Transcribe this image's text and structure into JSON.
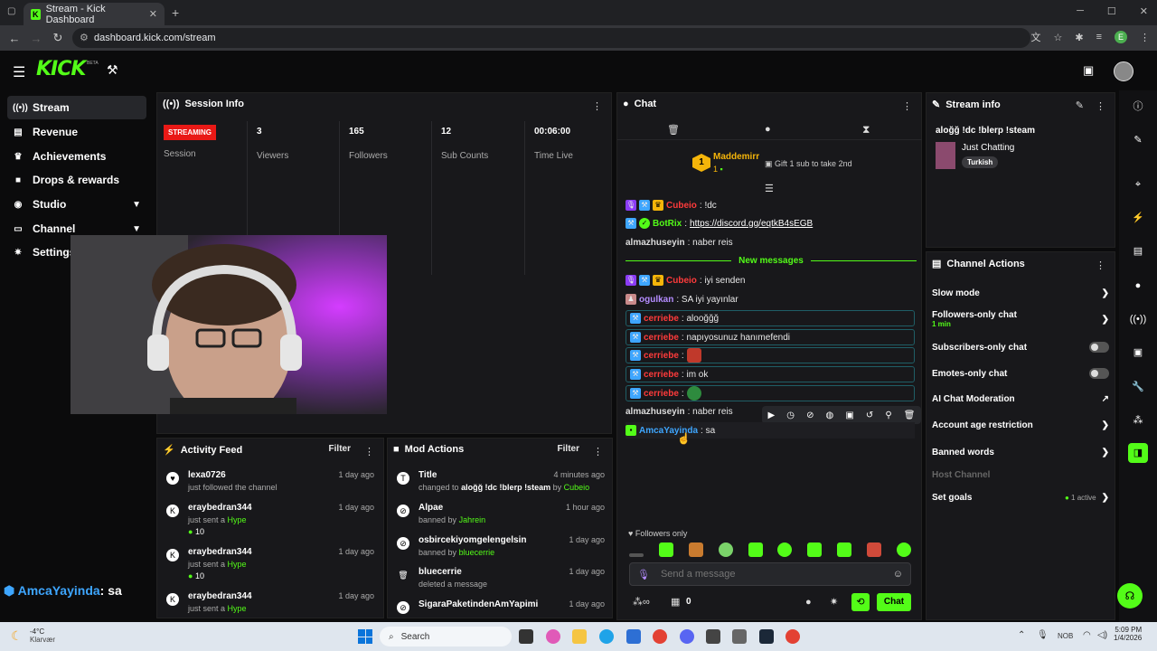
{
  "browser": {
    "tab_title": "Stream - Kick Dashboard",
    "url": "dashboard.kick.com/stream",
    "profile_initial": "E"
  },
  "header": {
    "logo": "KICK",
    "beta": "BETA"
  },
  "sidebar": {
    "items": [
      {
        "label": "Stream",
        "icon": "broadcast-icon"
      },
      {
        "label": "Revenue",
        "icon": "revenue-icon"
      },
      {
        "label": "Achievements",
        "icon": "trophy-icon"
      },
      {
        "label": "Drops & rewards",
        "icon": "gift-icon"
      },
      {
        "label": "Studio",
        "icon": "studio-icon"
      },
      {
        "label": "Channel",
        "icon": "channel-icon"
      },
      {
        "label": "Settings",
        "icon": "gear-icon"
      }
    ]
  },
  "session": {
    "title": "Session Info",
    "status_badge": "STREAMING",
    "status_label": "Session",
    "stats": [
      {
        "value": "3",
        "label": "Viewers"
      },
      {
        "value": "165",
        "label": "Followers"
      },
      {
        "value": "12",
        "label": "Sub Counts"
      },
      {
        "value": "00:06:00",
        "label": "Time Live"
      }
    ]
  },
  "overlay": {
    "user": "AmcaYayinda",
    "message": ": sa"
  },
  "activity": {
    "title": "Activity Feed",
    "filter": "Filter",
    "items": [
      {
        "name": "lexa0726",
        "detail": "just followed the channel",
        "time": "1 day ago"
      },
      {
        "name": "eraybedran344",
        "detail": "just sent a",
        "highlight": "Hype",
        "amount": "10",
        "time": "1 day ago"
      },
      {
        "name": "eraybedran344",
        "detail": "just sent a",
        "highlight": "Hype",
        "amount": "10",
        "time": "1 day ago"
      },
      {
        "name": "eraybedran344",
        "detail": "just sent a",
        "highlight": "Hype",
        "time": "1 day ago"
      }
    ]
  },
  "mod": {
    "title": "Mod Actions",
    "filter": "Filter",
    "items": [
      {
        "name": "Title",
        "detail": "changed to",
        "target": "aloğğ !dc !blerp !steam",
        "by": "by",
        "actor": "Cubeio",
        "time": "4 minutes ago"
      },
      {
        "name": "Alpae",
        "detail": "banned by",
        "actor": "Jahrein",
        "time": "1 hour ago"
      },
      {
        "name": "osbircekiyomgelengelsin",
        "detail": "banned by",
        "actor": "bluecerrie",
        "time": "1 day ago"
      },
      {
        "name": "bluecerrie",
        "detail": "deleted a message",
        "time": "1 day ago"
      },
      {
        "name": "SigaraPaketindenAmYapimi",
        "detail": "",
        "time": "1 day ago"
      }
    ]
  },
  "chat": {
    "title": "Chat",
    "pinned_user": "Maddemirr",
    "pinned_rank": "1",
    "pinned_count": "1",
    "gift_text": "Gift 1 sub to take 2nd",
    "new_messages": "New messages",
    "messages": [
      {
        "user": "Cubeio",
        "text": ": !dc"
      },
      {
        "user": "BotRix",
        "text": ": ",
        "link": "https://discord.gg/eqtkB4sEGB"
      },
      {
        "user": "almazhuseyin",
        "text": ": naber reis"
      },
      {
        "user": "Cubeio",
        "text": ": iyi senden"
      },
      {
        "user": "ogulkan",
        "text": ": SA iyi yayınlar"
      },
      {
        "user": "cerriebe",
        "text": ": aloоğğğ"
      },
      {
        "user": "cerriebe",
        "text": ": napıyosunuz hanımefendi"
      },
      {
        "user": "cerriebe",
        "text": ":"
      },
      {
        "user": "cerriebe",
        "text": ": im ok"
      },
      {
        "user": "cerriebe",
        "text": ":"
      },
      {
        "user": "almazhuseyin",
        "text": ": naber reis"
      },
      {
        "user": "AmcaYayinda",
        "text": ": sa"
      }
    ],
    "followers_only": "Followers only",
    "input_placeholder": "Send a message",
    "points": "0",
    "send_button": "Chat"
  },
  "stream_info": {
    "title": "Stream info",
    "stream_title": "aloğğ !dc !blerp !steam",
    "category": "Just Chatting",
    "tag": "Turkish"
  },
  "channel_actions": {
    "title": "Channel Actions",
    "items": [
      {
        "label": "Slow mode"
      },
      {
        "label": "Followers-only chat",
        "sub": "1 min"
      },
      {
        "label": "Subscribers-only chat"
      },
      {
        "label": "Emotes-only chat"
      },
      {
        "label": "AI Chat Moderation"
      },
      {
        "label": "Account age restriction"
      },
      {
        "label": "Banned words"
      },
      {
        "label": "Host Channel"
      },
      {
        "label": "Set goals",
        "status": "1 active"
      }
    ]
  },
  "taskbar": {
    "weather_temp": "-4°C",
    "weather_desc": "Klarvær",
    "search": "Search",
    "lang": "NOB",
    "time": "5:09 PM",
    "date": "1/4/2026"
  },
  "colors": {
    "accent": "#53fc18",
    "panel": "#18181b",
    "streaming_badge": "#e91916"
  }
}
